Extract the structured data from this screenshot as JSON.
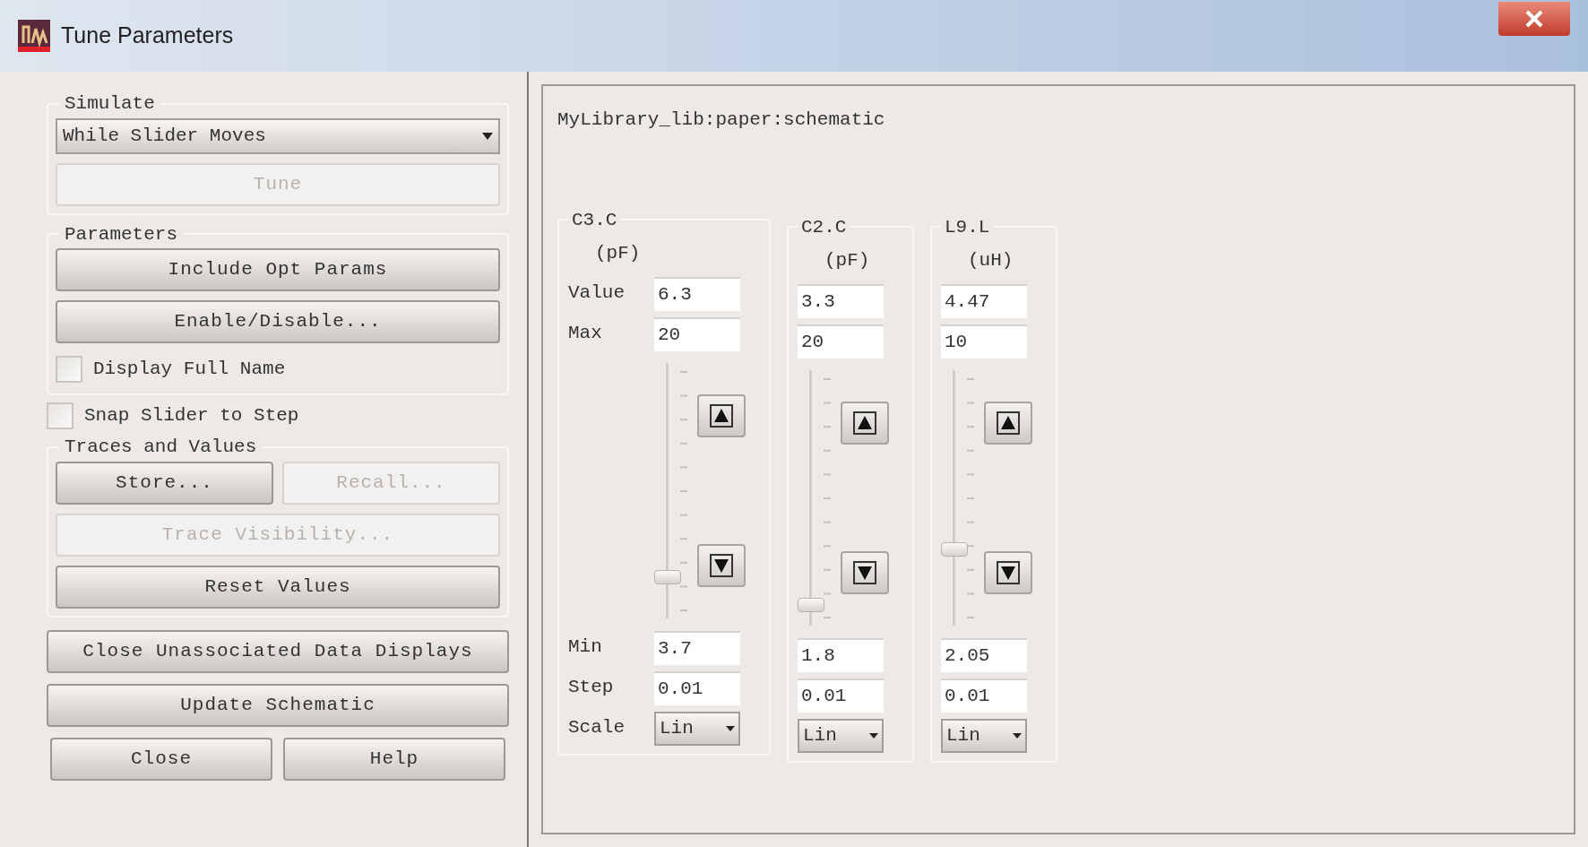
{
  "window": {
    "title": "Tune Parameters"
  },
  "simulate": {
    "label": "Simulate",
    "mode": "While Slider Moves",
    "tune": {
      "label": "Tune",
      "disabled": true
    }
  },
  "parameters": {
    "label": "Parameters",
    "buttons": [
      {
        "label": "Include Opt Params",
        "disabled": false
      },
      {
        "label": "Enable/Disable...",
        "disabled": false
      }
    ],
    "display_full_name": {
      "label": "Display Full Name",
      "checked": false
    }
  },
  "snap_slider": {
    "label": "Snap Slider to Step",
    "checked": false
  },
  "traces": {
    "label": "Traces and Values",
    "store": {
      "label": "Store...",
      "disabled": false
    },
    "recall": {
      "label": "Recall...",
      "disabled": true
    },
    "visibility": {
      "label": "Trace Visibility...",
      "disabled": true
    },
    "reset": {
      "label": "Reset Values",
      "disabled": false
    }
  },
  "bottom_buttons": [
    {
      "label": "Close Unassociated Data Displays"
    },
    {
      "label": "Update Schematic"
    }
  ],
  "dialog_buttons": [
    {
      "label": "Close"
    },
    {
      "label": "Help"
    }
  ],
  "schematic_path": "MyLibrary_lib:paper:schematic",
  "row_labels": {
    "value": "Value",
    "max": "Max",
    "min": "Min",
    "step": "Step",
    "scale": "Scale"
  },
  "tuners": [
    {
      "name": "C3.C",
      "unit": "(pF)",
      "value": "6.3",
      "max": "20",
      "min": "3.7",
      "step": "0.01",
      "scale": "Lin",
      "level": 0.16
    },
    {
      "name": "C2.C",
      "unit": "(pF)",
      "value": "3.3",
      "max": "20",
      "min": "1.8",
      "step": "0.01",
      "scale": "Lin",
      "level": 0.08
    },
    {
      "name": "L9.L",
      "unit": "(uH)",
      "value": "4.47",
      "max": "10",
      "min": "2.05",
      "step": "0.01",
      "scale": "Lin",
      "level": 0.3
    }
  ]
}
